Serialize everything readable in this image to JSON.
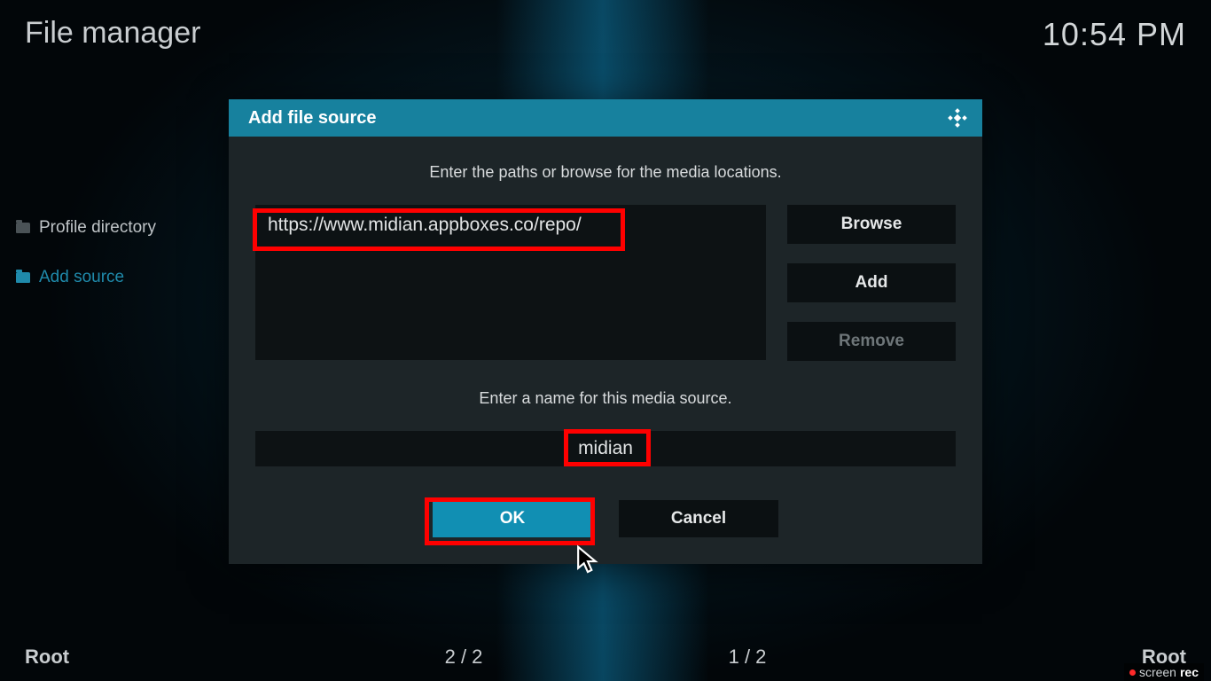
{
  "header": {
    "title": "File manager",
    "time": "10:54 PM"
  },
  "sidebar": {
    "items": [
      {
        "label": "Profile directory",
        "accent": false
      },
      {
        "label": "Add source",
        "accent": true
      }
    ]
  },
  "dialog": {
    "title": "Add file source",
    "instruction_paths": "Enter the paths or browse for the media locations.",
    "url_value": "https://www.midian.appboxes.co/repo/",
    "buttons": {
      "browse": "Browse",
      "add": "Add",
      "remove": "Remove"
    },
    "instruction_name": "Enter a name for this media source.",
    "name_value": "midian",
    "ok_label": "OK",
    "cancel_label": "Cancel"
  },
  "footer": {
    "left_label": "Root",
    "pager_left": "2 / 2",
    "pager_right": "1 / 2",
    "right_label": "Root"
  },
  "watermark": {
    "part1": "screen",
    "part2": "rec"
  },
  "colors": {
    "accent": "#17819e",
    "highlight": "#ff0000"
  }
}
